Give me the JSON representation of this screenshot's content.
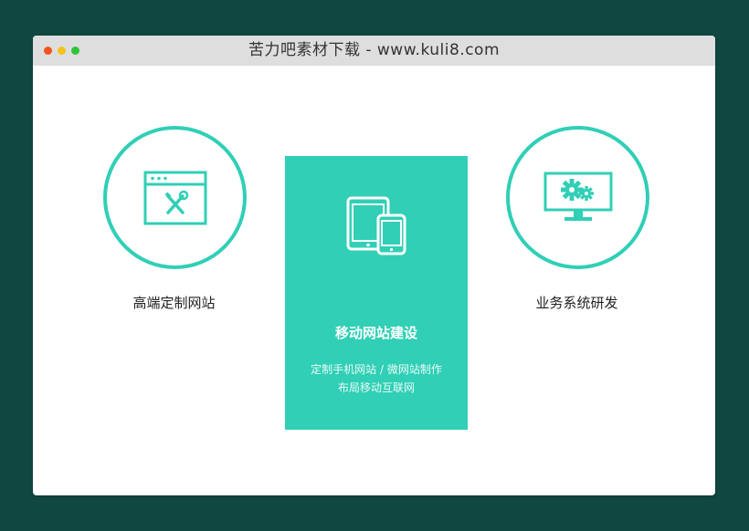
{
  "window": {
    "title": "苦力吧素材下载 - www.kuli8.com",
    "controls": [
      {
        "name": "close",
        "color": "#f4531e"
      },
      {
        "name": "minimize",
        "color": "#f5c21c"
      },
      {
        "name": "zoom",
        "color": "#2fc43a"
      }
    ]
  },
  "colors": {
    "accent": "#30cfb6",
    "background": "#114741"
  },
  "services": [
    {
      "label": "高端定制网站",
      "icon": "browser-tools-icon"
    },
    {
      "label": "移动网站建设",
      "icon": "tablet-phone-icon",
      "desc_line1": "定制手机网站 / 微网站制作",
      "desc_line2": "布局移动互联网"
    },
    {
      "label": "业务系统研发",
      "icon": "monitor-gears-icon"
    }
  ]
}
